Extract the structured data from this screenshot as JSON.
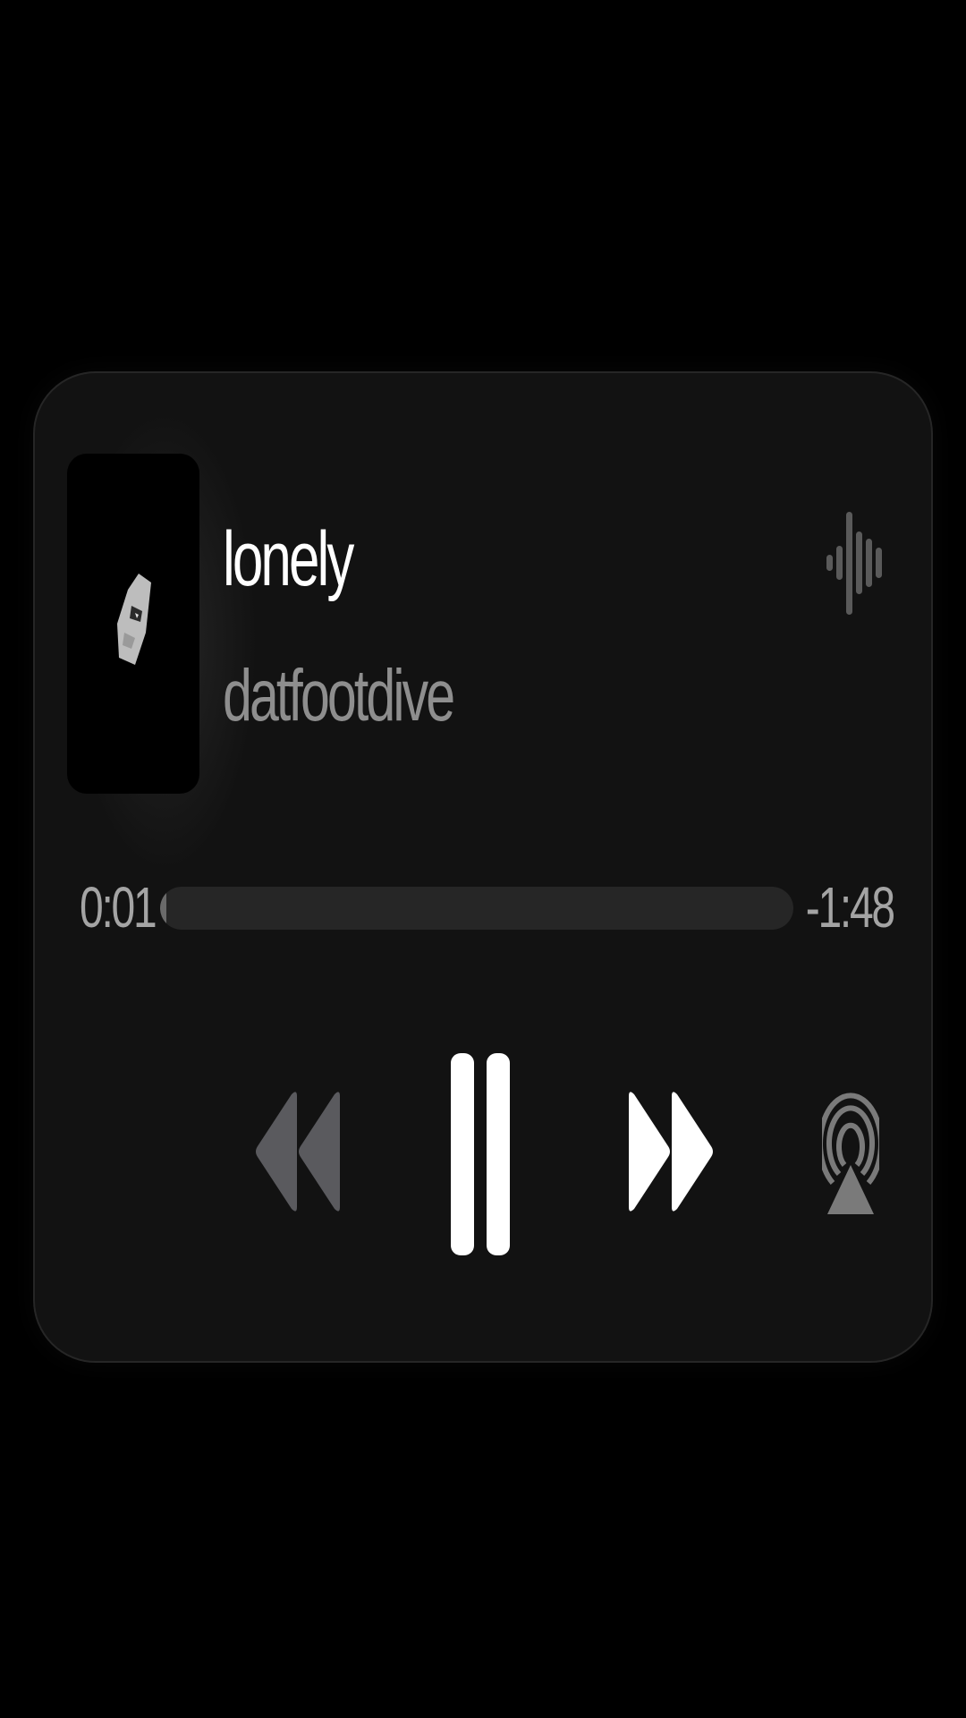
{
  "now_playing": {
    "title": "lonely",
    "artist": "datfootdive",
    "time_elapsed": "0:01",
    "time_remaining": "-1:48",
    "progress": 0.01,
    "state": "playing"
  },
  "icons": {
    "waveform": "waveform-icon",
    "rewind": "backward-icon",
    "pause": "pause-icon",
    "forward": "forward-icon",
    "airplay": "airplay-icon"
  },
  "colors": {
    "background": "#000000",
    "card": "#121212",
    "title": "#ffffff",
    "artist": "#8e8e8e",
    "time": "#a4a4a4",
    "track": "#262626",
    "rewind_disabled": "#5a5a5e",
    "icon_dim": "#5a5a5a"
  }
}
